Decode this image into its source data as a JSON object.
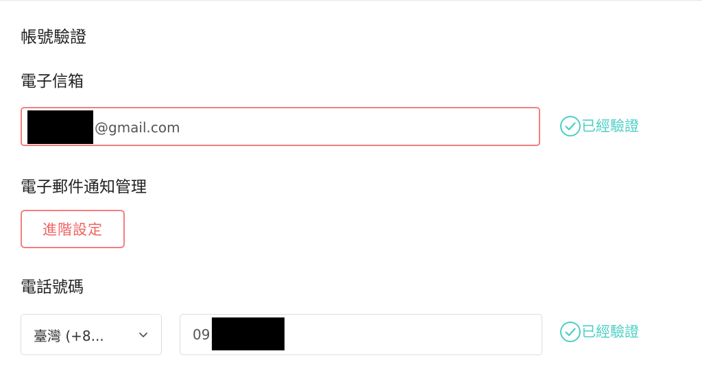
{
  "colors": {
    "accent_red": "#f47e7e",
    "verified_teal": "#4ccfc4"
  },
  "account_verification": {
    "title": "帳號驗證"
  },
  "email": {
    "label": "電子信箱",
    "value_visible": "@gmail.com",
    "status": "已經驗證",
    "status_icon": "check-circle-icon"
  },
  "email_notifications": {
    "label": "電子郵件通知管理",
    "button_label": "進階設定"
  },
  "phone": {
    "label": "電話號碼",
    "country_selected": "臺灣 (+8...",
    "country_dropdown_icon": "chevron-down-icon",
    "value_visible": "09",
    "status": "已經驗證",
    "status_icon": "check-circle-icon"
  }
}
